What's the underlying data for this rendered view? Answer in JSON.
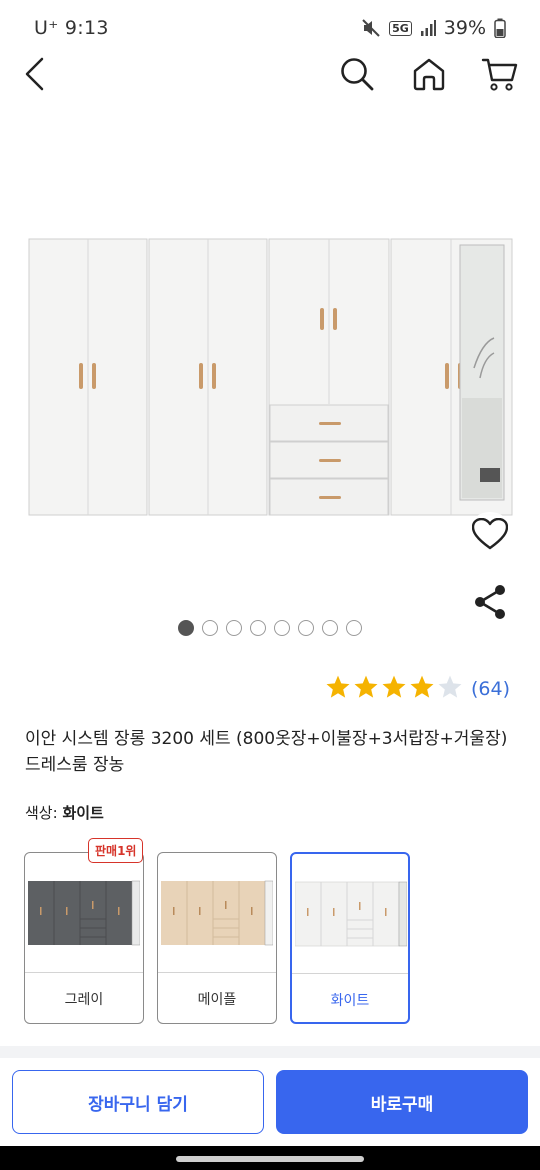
{
  "status_bar": {
    "carrier_time": "U⁺ 9:13",
    "network": "5G",
    "battery": "39%"
  },
  "nav": {
    "back_icon": "chevron-left-icon",
    "search_icon": "search-icon",
    "home_icon": "home-icon",
    "cart_icon": "cart-icon"
  },
  "gallery": {
    "image_count": 8,
    "active_index": 0,
    "wishlist_icon": "heart-icon",
    "share_icon": "share-icon"
  },
  "rating": {
    "stars": 4,
    "max_stars": 5,
    "count_text": "(64)",
    "star_color": "#f5b301",
    "empty_star_color": "#dde3ea"
  },
  "product": {
    "title": "이안 시스템 장롱 3200 세트 (800옷장+이불장+3서랍장+거울장) 드레스룸 장농"
  },
  "color_option": {
    "label": "색상: ",
    "selected_value": "화이트",
    "options": [
      {
        "label": "그레이",
        "badge": "판매1위",
        "swatch": "#5d6063"
      },
      {
        "label": "메이플",
        "badge": "",
        "swatch": "#e8d3b8"
      },
      {
        "label": "화이트",
        "badge": "",
        "swatch": "#f2f2f1"
      }
    ]
  },
  "actions": {
    "cart_label": "장바구니 담기",
    "buy_label": "바로구매"
  },
  "colors": {
    "accent": "#3866ee",
    "badge_red": "#d6342a",
    "rating_link": "#3b6fd8"
  }
}
